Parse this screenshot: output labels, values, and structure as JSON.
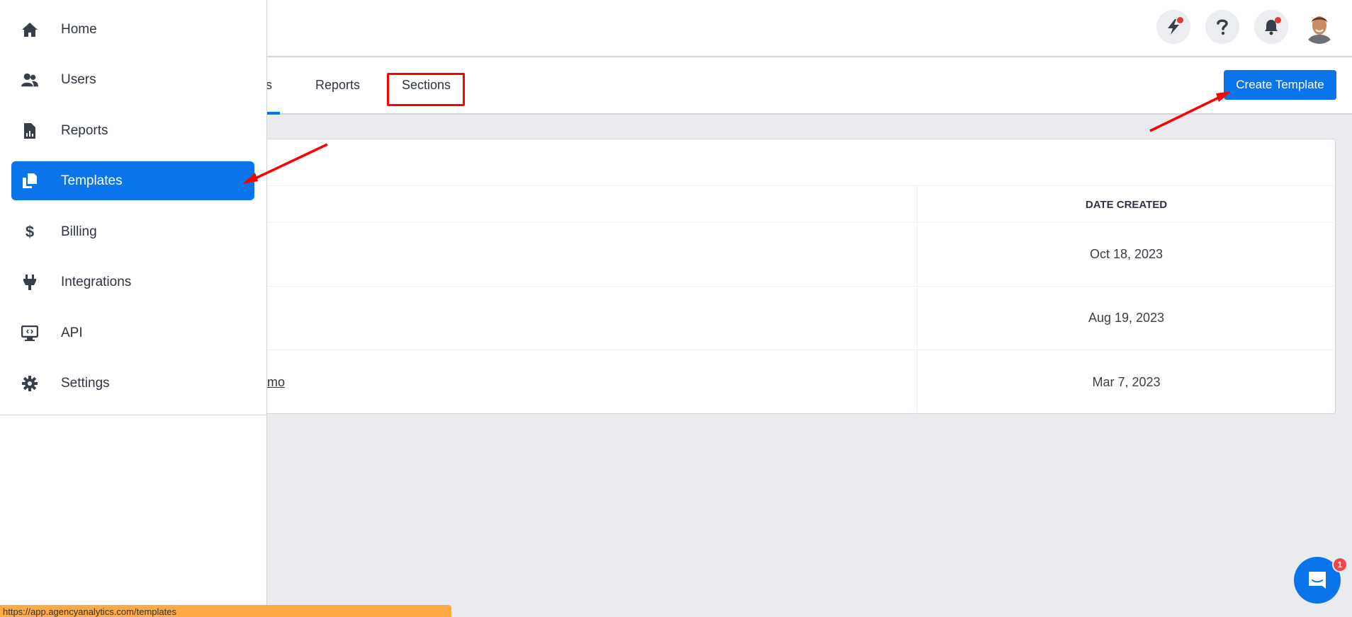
{
  "header": {
    "icons": [
      {
        "name": "whats-new",
        "icon": "lightning-icon",
        "has_notification_dot": true
      },
      {
        "name": "help",
        "icon": "question-icon",
        "has_notification_dot": false
      },
      {
        "name": "notifications",
        "icon": "bell-icon",
        "has_notification_dot": true
      }
    ],
    "avatar_alt": "User avatar"
  },
  "sidebar": {
    "items": [
      {
        "label": "Home",
        "icon": "home-icon",
        "active": false
      },
      {
        "label": "Users",
        "icon": "users-icon",
        "active": false
      },
      {
        "label": "Reports",
        "icon": "report-file-icon",
        "active": false
      },
      {
        "label": "Templates",
        "icon": "copy-files-icon",
        "active": true
      },
      {
        "label": "Billing",
        "icon": "dollar-icon",
        "active": false
      },
      {
        "label": "Integrations",
        "icon": "plug-icon",
        "active": false
      },
      {
        "label": "API",
        "icon": "monitor-code-icon",
        "active": false
      },
      {
        "label": "Settings",
        "icon": "gear-icon",
        "active": false
      }
    ]
  },
  "tabs": {
    "items": [
      {
        "label": "ns",
        "active": true
      },
      {
        "label": "Reports",
        "active": false
      },
      {
        "label": "Sections",
        "active": false
      }
    ],
    "create_button": "Create Template"
  },
  "table": {
    "columns": [
      "DATE CREATED"
    ],
    "rows": [
      {
        "name": "",
        "date": "Oct 18, 2023"
      },
      {
        "name": "",
        "date": "Aug 19, 2023"
      },
      {
        "name": "mo",
        "date": "Mar 7, 2023"
      }
    ]
  },
  "chat": {
    "badge_count": "1"
  },
  "status_bar": {
    "url": "https://app.agencyanalytics.com/templates"
  },
  "colors": {
    "accent": "#0a74ea",
    "annotation": "#ff0000",
    "status_bar": "#ffaa44"
  }
}
